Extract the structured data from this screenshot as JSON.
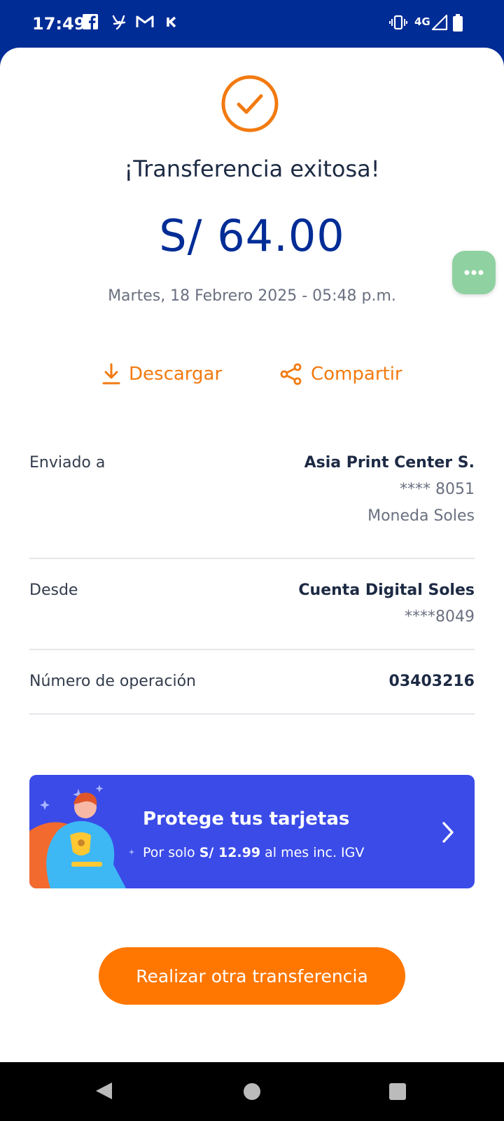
{
  "status_bar": {
    "time": "17:49",
    "network": "4G",
    "left_icons": [
      "facebook-icon",
      "y-app-icon",
      "gmail-icon",
      "k-app-icon"
    ],
    "right_icons": [
      "vibrate-icon",
      "signal-icon",
      "battery-icon"
    ]
  },
  "header": {
    "title": "¡Transferencia exitosa!",
    "amount": "S/ 64.00",
    "datetime": "Martes, 18 Febrero 2025 - 05:48 p.m.",
    "icon": "check-circle-icon"
  },
  "actions": {
    "download_label": "Descargar",
    "share_label": "Compartir"
  },
  "details": {
    "sent_to": {
      "label": "Enviado a",
      "name": "Asia Print Center S.",
      "account": "**** 8051",
      "currency": "Moneda Soles"
    },
    "from": {
      "label": "Desde",
      "account_name": "Cuenta Digital Soles",
      "account": "****8049"
    },
    "operation": {
      "label": "Número de operación",
      "number": "03403216"
    }
  },
  "promo": {
    "title": "Protege tus tarjetas",
    "sub_prefix": "Por solo ",
    "sub_price": "S/ 12.99",
    "sub_suffix": " al mes inc. IGV"
  },
  "cta": {
    "label": "Realizar otra transferencia"
  },
  "colors": {
    "brand_blue": "#002c96",
    "accent_orange": "#f27a10",
    "cta_orange": "#ff7700",
    "promo_blue": "#3b4be8",
    "fab_green": "#8fd1a0"
  }
}
